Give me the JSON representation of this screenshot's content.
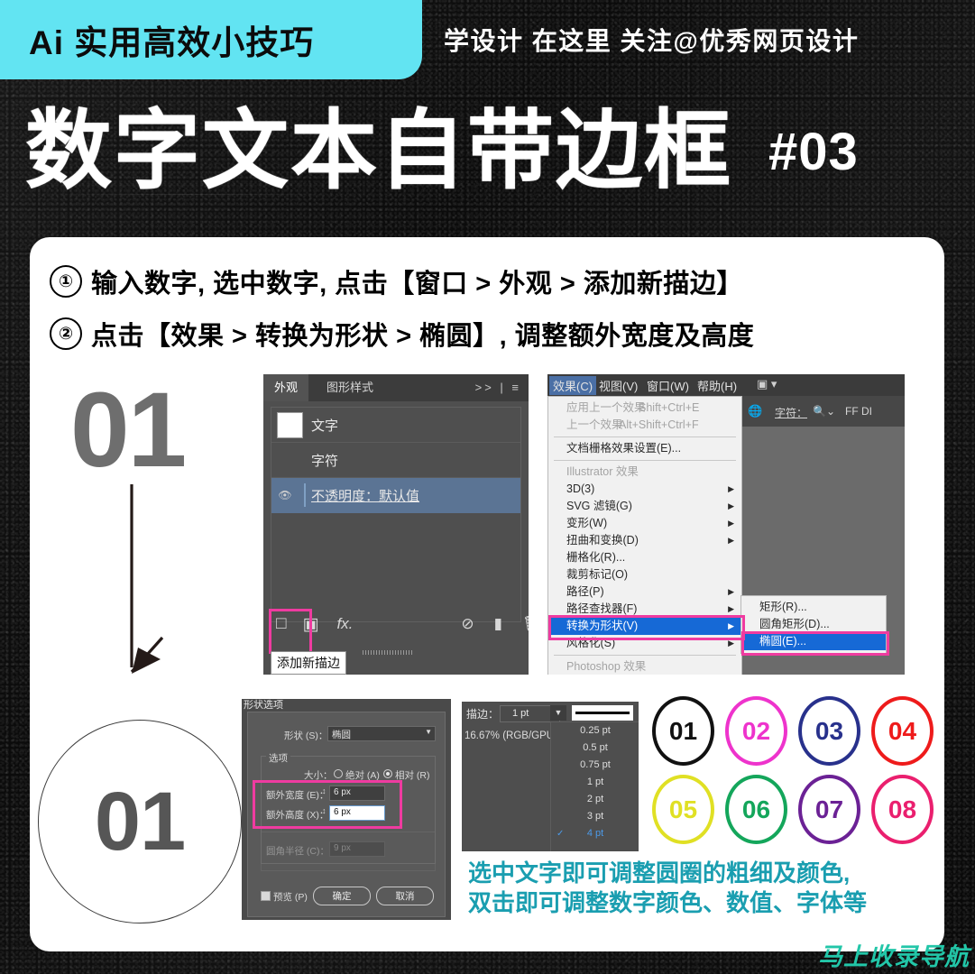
{
  "header": {
    "tag_label": "Ai 实用高效小技巧",
    "right_label": "学设计 在这里  关注@优秀网页设计",
    "tag_bg": "#62e4f2"
  },
  "title": {
    "main": "数字文本自带边框",
    "number": "#03"
  },
  "steps": [
    {
      "badge": "①",
      "text": "输入数字, 选中数字, 点击【窗口 > 外观 > 添加新描边】"
    },
    {
      "badge": "②",
      "text": "点击【效果 > 转换为形状 > 椭圆】, 调整额外宽度及高度"
    }
  ],
  "left_column": {
    "big_number": "01",
    "circled_number": "01",
    "arrow": "down-arrow"
  },
  "appearance_panel": {
    "tabs": [
      {
        "label": "外观",
        "active": true
      },
      {
        "label": "图形样式",
        "active": false
      }
    ],
    "panel_icons": ">> | ≡",
    "rows": [
      {
        "label": "文字",
        "has_swatch": true,
        "selected": false,
        "underline": false
      },
      {
        "label": "字符",
        "has_swatch": false,
        "selected": false,
        "underline": false
      },
      {
        "label": "不透明度：默认值",
        "has_swatch": false,
        "selected": true,
        "underline": true
      }
    ],
    "footer_icons": [
      "add-new-stroke",
      "add-new-fill",
      "fx",
      "clear-appearance",
      "duplicate-item",
      "delete-item"
    ],
    "tooltip": "添加新描边",
    "highlight_color": "#ef3ba0"
  },
  "effects_menu": {
    "menubar": [
      "效果(C)",
      "视图(V)",
      "窗口(W)",
      "帮助(H)"
    ],
    "active_menu": "效果(C)",
    "toolbar": {
      "char_label": "字符：",
      "font_value": "FF DI"
    },
    "zoom_bar": "",
    "items": [
      {
        "label": "应用上一个效果",
        "shortcut": "Shift+Ctrl+E",
        "disabled": true,
        "submenu": false
      },
      {
        "label": "上一个效果",
        "shortcut": "Alt+Shift+Ctrl+F",
        "disabled": true,
        "submenu": false
      },
      {
        "label": "文档栅格效果设置(E)...",
        "shortcut": "",
        "disabled": false,
        "submenu": false
      },
      {
        "label": "Illustrator 效果",
        "shortcut": "",
        "disabled": true,
        "submenu": false
      },
      {
        "label": "3D(3)",
        "shortcut": "",
        "disabled": false,
        "submenu": true
      },
      {
        "label": "SVG 滤镜(G)",
        "shortcut": "",
        "disabled": false,
        "submenu": true
      },
      {
        "label": "变形(W)",
        "shortcut": "",
        "disabled": false,
        "submenu": true
      },
      {
        "label": "扭曲和变换(D)",
        "shortcut": "",
        "disabled": false,
        "submenu": true
      },
      {
        "label": "栅格化(R)...",
        "shortcut": "",
        "disabled": false,
        "submenu": false
      },
      {
        "label": "裁剪标记(O)",
        "shortcut": "",
        "disabled": false,
        "submenu": false
      },
      {
        "label": "路径(P)",
        "shortcut": "",
        "disabled": false,
        "submenu": true
      },
      {
        "label": "路径查找器(F)",
        "shortcut": "",
        "disabled": false,
        "submenu": true
      },
      {
        "label": "转换为形状(V)",
        "shortcut": "",
        "disabled": false,
        "submenu": true,
        "selected": true
      },
      {
        "label": "风格化(S)",
        "shortcut": "",
        "disabled": false,
        "submenu": true
      },
      {
        "label": "Photoshop 效果",
        "shortcut": "",
        "disabled": true,
        "submenu": false
      }
    ],
    "submenu": [
      {
        "label": "矩形(R)...",
        "selected": false
      },
      {
        "label": "圆角矩形(D)...",
        "selected": false
      },
      {
        "label": "椭圆(E)...",
        "selected": true
      }
    ],
    "highlight_color": "#ef3ba0"
  },
  "shape_options_dialog": {
    "title": "形状选项",
    "shape_label": "形状 (S)：",
    "shape_value": "椭圆",
    "options_label": "选项",
    "size_label": "大小：",
    "size_absolute": "绝对 (A)",
    "size_relative": "相对 (R)",
    "size_selected": "相对 (R)",
    "extra_width_label": "额外宽度 (E)：",
    "extra_width_value": "6 px",
    "extra_height_label": "额外高度 (X)：",
    "extra_height_value": "6 px",
    "corner_radius_label": "圆角半径 (C)：",
    "corner_radius_value": "9 px",
    "preview_label": "预览 (P)",
    "ok_label": "确定",
    "cancel_label": "取消",
    "highlight_color": "#ef3ba0"
  },
  "stroke_dropdown": {
    "label": "描边：",
    "value": "1 pt",
    "zoom_status": "16.67% (RGB/GPU",
    "options": [
      "0.25 pt",
      "0.5 pt",
      "0.75 pt",
      "1 pt",
      "2 pt",
      "3 pt",
      "4 pt"
    ],
    "checked": "4 pt"
  },
  "swatches": {
    "rows": [
      [
        {
          "label": "01",
          "color": "#111111"
        },
        {
          "label": "02",
          "color": "#ee33cc"
        },
        {
          "label": "03",
          "color": "#28318c"
        },
        {
          "label": "04",
          "color": "#ee1b1b"
        }
      ],
      [
        {
          "label": "05",
          "color": "#e0e024"
        },
        {
          "label": "06",
          "color": "#14a65b"
        },
        {
          "label": "07",
          "color": "#6b2195"
        },
        {
          "label": "08",
          "color": "#ea1f6e"
        }
      ]
    ]
  },
  "caption": {
    "line1": "选中文字即可调整圆圈的粗细及颜色,",
    "line2": "双击即可调整数字颜色、数值、字体等",
    "color": "#1a9eb0"
  },
  "watermark": {
    "text": "马上收录导航",
    "color": "#22c6a8"
  }
}
